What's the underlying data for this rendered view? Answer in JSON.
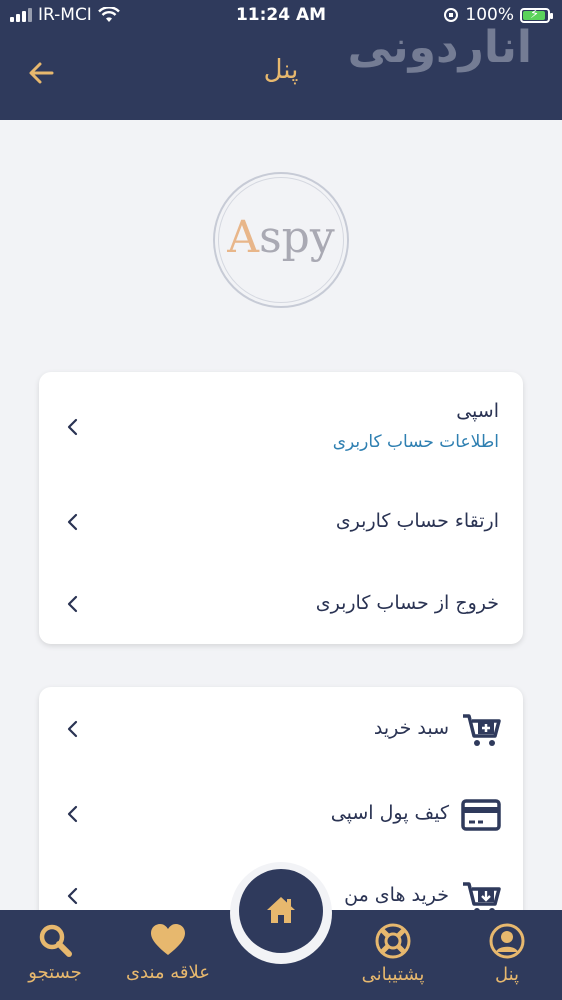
{
  "status_bar": {
    "carrier": "IR-MCI",
    "time": "11:24 AM",
    "battery": "100%"
  },
  "header": {
    "title": "پنل",
    "watermark": "اناردونی"
  },
  "logo": {
    "text_a": "A",
    "text_rest": "spy"
  },
  "account_card": {
    "profile": {
      "name": "اسپی",
      "link": "اطلاعات حساب کاربری"
    },
    "upgrade": "ارتقاء حساب کاربری",
    "logout": "خروج از حساب کاربری"
  },
  "menu_card": {
    "cart": "سبد خرید",
    "wallet": "کیف پول اسپی",
    "purchases": "خرید های من"
  },
  "bottom_nav": {
    "search": "جستجو",
    "favorites": "علاقه مندی",
    "support": "پشتیبانی",
    "panel": "پنل"
  },
  "colors": {
    "primary": "#2f3a5c",
    "accent": "#e7b86e",
    "link": "#2e7fb1",
    "background": "#f2f3f6"
  }
}
